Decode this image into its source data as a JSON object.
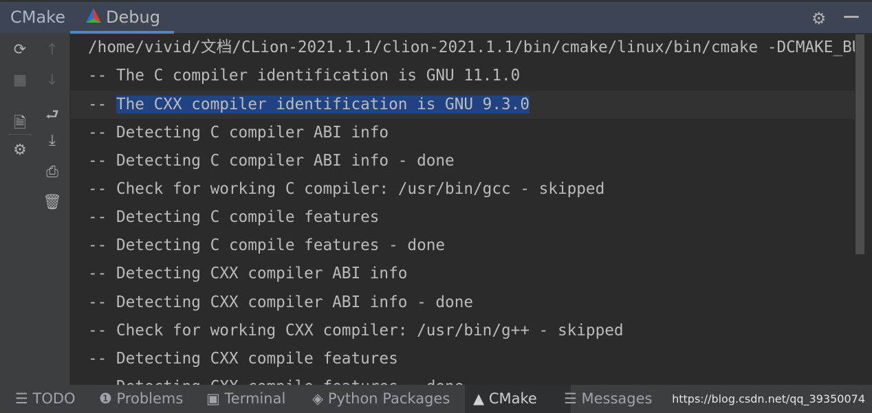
{
  "header": {
    "tabs": [
      {
        "label": "CMake"
      },
      {
        "label": "Debug",
        "active": true
      }
    ],
    "settings_icon": "gear-icon",
    "minimize_icon": "minimize-icon"
  },
  "toolbar": {
    "left": [
      "reload-icon",
      "stop-icon",
      "cmake-settings-icon",
      "settings-icon"
    ],
    "right": [
      "arrow-up-icon",
      "arrow-down-icon",
      "soft-wrap-icon",
      "scroll-to-end-icon",
      "print-icon",
      "trash-icon"
    ]
  },
  "console": {
    "lines": [
      "/home/vivid/文档/CLion-2021.1.1/clion-2021.1.1/bin/cmake/linux/bin/cmake -DCMAKE_BU",
      "-- The C compiler identification is GNU 11.1.0",
      "-- The CXX compiler identification is GNU 9.3.0",
      "-- Detecting C compiler ABI info",
      "-- Detecting C compiler ABI info - done",
      "-- Check for working C compiler: /usr/bin/gcc - skipped",
      "-- Detecting C compile features",
      "-- Detecting C compile features - done",
      "-- Detecting CXX compiler ABI info",
      "-- Detecting CXX compiler ABI info - done",
      "-- Check for working CXX compiler: /usr/bin/g++ - skipped",
      "-- Detecting CXX compile features",
      "-- Detecting CXX compile features - done"
    ],
    "selected_prefix": "-- ",
    "selected_text": "The CXX compiler identification is GNU 9.3.0"
  },
  "bottom": {
    "tabs": [
      {
        "label": "TODO"
      },
      {
        "label": "Problems"
      },
      {
        "label": "Terminal"
      },
      {
        "label": "Python Packages"
      },
      {
        "label": "CMake",
        "active": true
      },
      {
        "label": "Messages"
      }
    ],
    "watermark": "https://blog.csdn.net/qq_39350074"
  },
  "colors": {
    "selection": "#214283",
    "accent": "#4a88c7",
    "background": "#2b2b2b"
  }
}
